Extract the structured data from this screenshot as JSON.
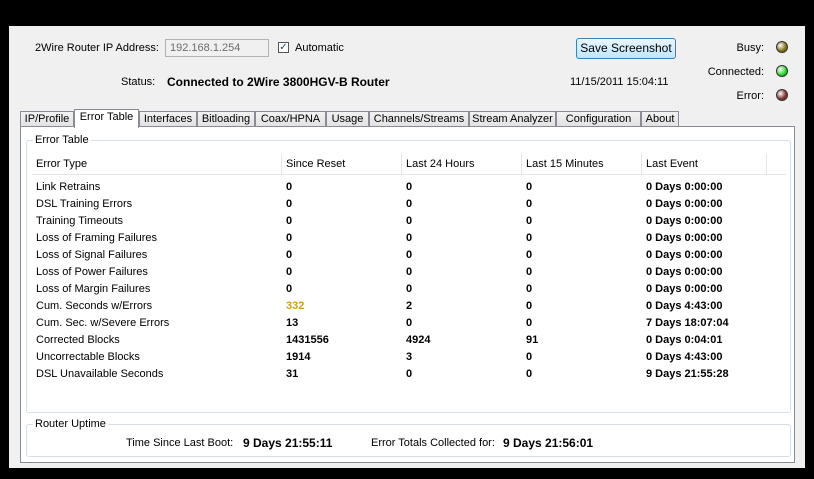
{
  "top": {
    "ip_label": "2Wire Router IP Address:",
    "ip_value": "192.168.1.254",
    "automatic_checked": "✓",
    "automatic_label": "Automatic",
    "save_button": "Save Screenshot",
    "status_label": "Status:",
    "status_value": "Connected to 2Wire 3800HGV-B Router",
    "datetime": "11/15/2011 15:04:11"
  },
  "indicators": [
    {
      "label": "Busy:",
      "color": "#8a7a1c"
    },
    {
      "label": "Connected:",
      "color": "#2ee02e"
    },
    {
      "label": "Error:",
      "color": "#8b3a3a"
    }
  ],
  "tabs": [
    "IP/Profile",
    "Error Table",
    "Interfaces",
    "Bitloading",
    "Coax/HPNA",
    "Usage",
    "Channels/Streams",
    "Stream Analyzer",
    "Configuration",
    "About"
  ],
  "active_tab": "Error Table",
  "error_table": {
    "title": "Error Table",
    "columns": [
      "Error Type",
      "Since Reset",
      "Last 24 Hours",
      "Last 15 Minutes",
      "Last Event"
    ],
    "rows": [
      {
        "type": "Link Retrains",
        "since": "0",
        "h24": "0",
        "m15": "0",
        "last": "0 Days 0:00:00"
      },
      {
        "type": "DSL Training Errors",
        "since": "0",
        "h24": "0",
        "m15": "0",
        "last": "0 Days 0:00:00"
      },
      {
        "type": "Training Timeouts",
        "since": "0",
        "h24": "0",
        "m15": "0",
        "last": "0 Days 0:00:00"
      },
      {
        "type": "Loss of Framing Failures",
        "since": "0",
        "h24": "0",
        "m15": "0",
        "last": "0 Days 0:00:00"
      },
      {
        "type": "Loss of Signal Failures",
        "since": "0",
        "h24": "0",
        "m15": "0",
        "last": "0 Days 0:00:00"
      },
      {
        "type": "Loss of Power Failures",
        "since": "0",
        "h24": "0",
        "m15": "0",
        "last": "0 Days 0:00:00"
      },
      {
        "type": "Loss of Margin Failures",
        "since": "0",
        "h24": "0",
        "m15": "0",
        "last": "0 Days 0:00:00"
      },
      {
        "type": "Cum. Seconds w/Errors",
        "since": "332",
        "h24": "2",
        "m15": "0",
        "last": "0 Days 4:43:00",
        "highlight": "#d4a017"
      },
      {
        "type": "Cum. Sec. w/Severe Errors",
        "since": "13",
        "h24": "0",
        "m15": "0",
        "last": "7 Days 18:07:04"
      },
      {
        "type": "Corrected Blocks",
        "since": "1431556",
        "h24": "4924",
        "m15": "91",
        "last": "0 Days 0:04:01"
      },
      {
        "type": "Uncorrectable Blocks",
        "since": "1914",
        "h24": "3",
        "m15": "0",
        "last": "0 Days 4:43:00"
      },
      {
        "type": "DSL Unavailable Seconds",
        "since": "31",
        "h24": "0",
        "m15": "0",
        "last": "9 Days 21:55:28"
      }
    ]
  },
  "uptime": {
    "title": "Router Uptime",
    "boot_label": "Time Since Last Boot:",
    "boot_value": "9 Days 21:55:11",
    "totals_label": "Error Totals Collected for:",
    "totals_value": "9 Days 21:56:01"
  }
}
